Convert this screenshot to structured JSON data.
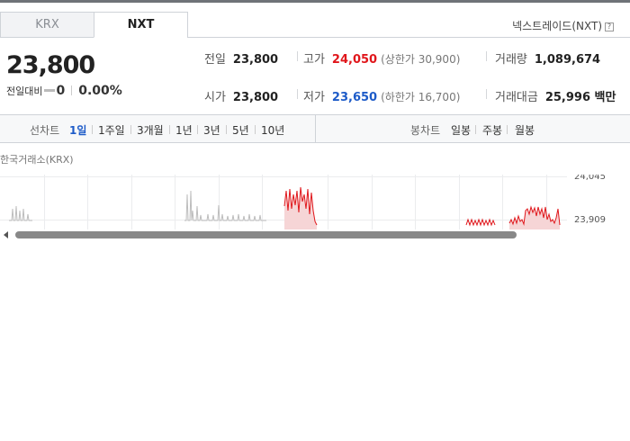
{
  "tabs": [
    {
      "label": "KRX",
      "active": false
    },
    {
      "label": "NXT",
      "active": true
    }
  ],
  "market": {
    "name": "넥스트레이드(NXT)",
    "help_icon": "?"
  },
  "quote": {
    "price": "23,800",
    "change_label": "전일대비",
    "change_value": "0",
    "change_rate": "0.00%"
  },
  "stats": {
    "prev_close": {
      "label": "전일",
      "value": "23,800"
    },
    "high": {
      "label": "고가",
      "value": "24,050",
      "limit": "(상한가 30,900)"
    },
    "volume": {
      "label": "거래량",
      "value": "1,089,674"
    },
    "open": {
      "label": "시가",
      "value": "23,800"
    },
    "low": {
      "label": "저가",
      "value": "23,650",
      "limit": "(하한가 16,700)"
    },
    "turnover": {
      "label": "거래대금",
      "value": "25,996 백만"
    }
  },
  "periods": {
    "line_chart_label": "선차트",
    "line_items": [
      "1일",
      "1주일",
      "3개월",
      "1년",
      "3년",
      "5년",
      "10년"
    ],
    "active": "1일",
    "candle_chart_label": "봉차트",
    "candle_items": [
      "일봉",
      "주봉",
      "월봉"
    ]
  },
  "chart": {
    "source_label": "한국거래소(KRX)",
    "y_ticks": [
      "24,045",
      "23,909"
    ]
  },
  "colors": {
    "up": "#e0161b",
    "down": "#1d5bc8",
    "flat_line": "#bdbdbd"
  }
}
